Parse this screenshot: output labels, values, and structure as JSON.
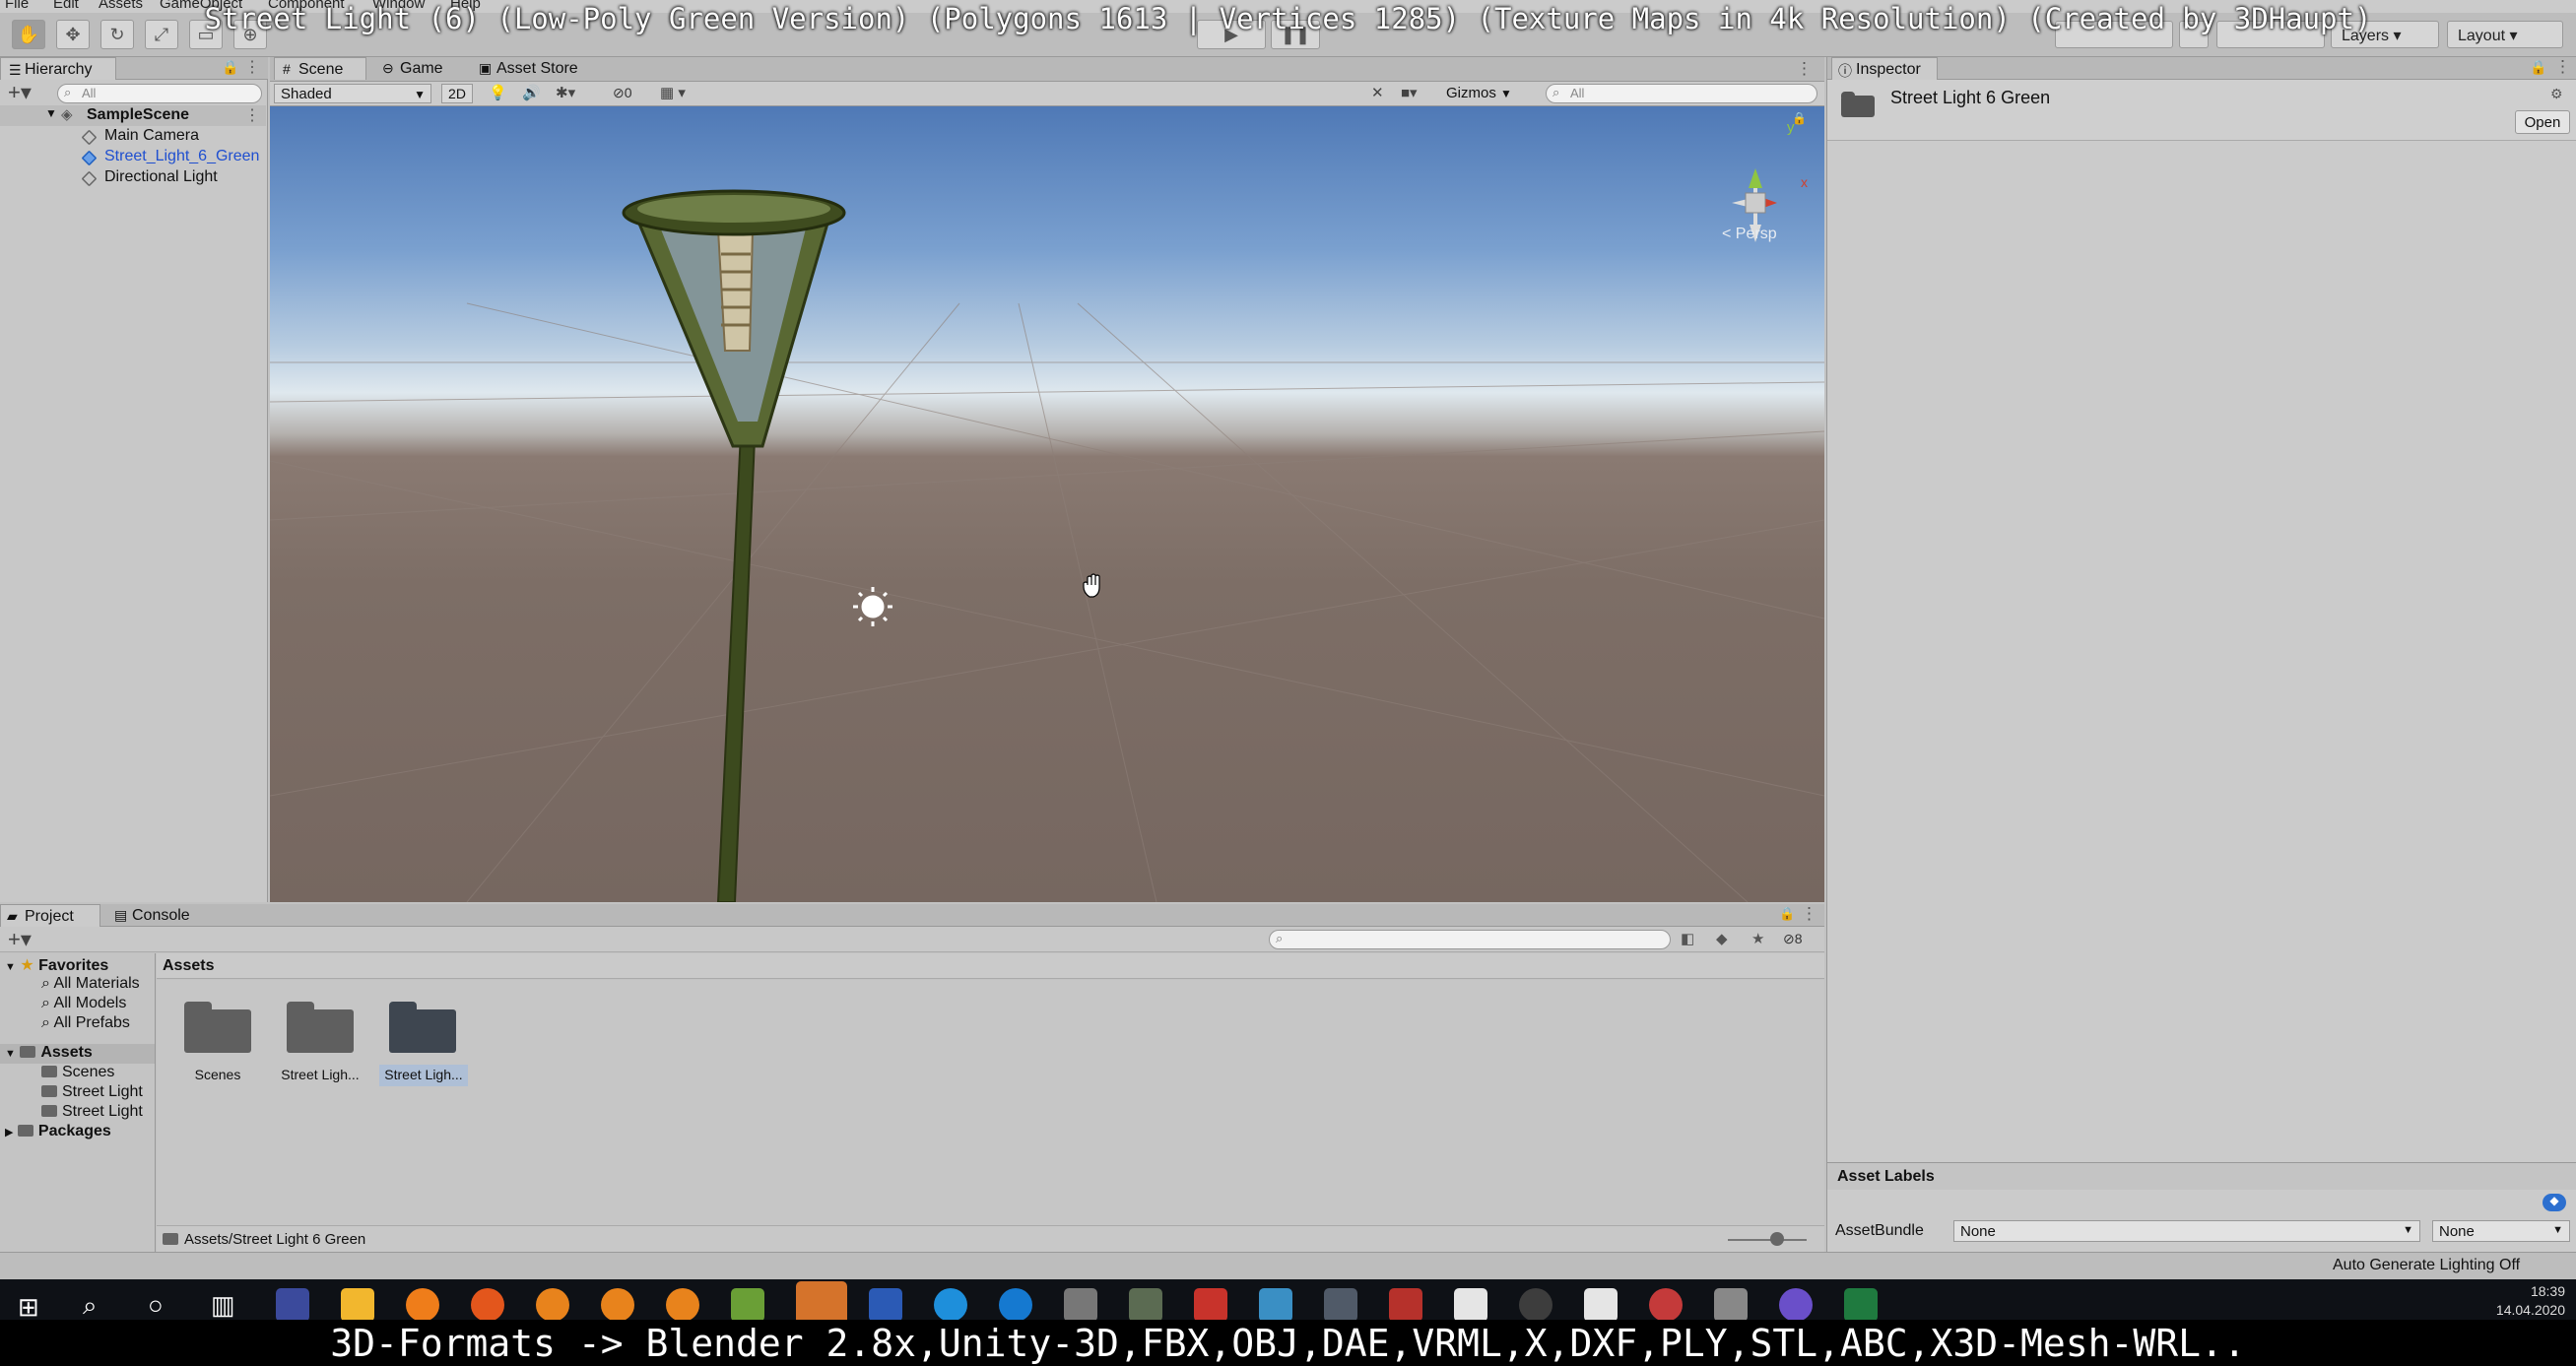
{
  "overlay": {
    "title": "Street Light (6) (Low-Poly Green Version) (Polygons 1613 | Vertices 1285) (Texture Maps in 4k Resolution) (Created by 3DHaupt)",
    "formats": "3D-Formats -> Blender 2.8x,Unity-3D,FBX,OBJ,DAE,VRML,X,DXF,PLY,STL,ABC,X3D-Mesh-WRL.."
  },
  "menu": [
    "File",
    "Edit",
    "Assets",
    "GameObject",
    "Component",
    "Window",
    "Help"
  ],
  "toolbar": {
    "layers": "Layers",
    "layout": "Layout"
  },
  "hierarchy": {
    "tab": "Hierarchy",
    "search_placeholder": "All",
    "scene": "SampleScene",
    "items": [
      "Main Camera",
      "Street_Light_6_Green",
      "Directional Light"
    ]
  },
  "scene_view": {
    "tabs": [
      "Scene",
      "Game",
      "Asset Store"
    ],
    "shading": "Shaded",
    "mode2d": "2D",
    "hidden_count": "0",
    "gizmos": "Gizmos",
    "search_placeholder": "All",
    "persp": "< Persp",
    "axis_x": "x",
    "axis_y": "y"
  },
  "inspector": {
    "tab": "Inspector",
    "asset_name": "Street Light 6 Green",
    "open_button": "Open",
    "asset_labels": "Asset Labels",
    "assetbundle_label": "AssetBundle",
    "assetbundle_value": "None",
    "variant_value": "None"
  },
  "project": {
    "tabs": [
      "Project",
      "Console"
    ],
    "badge": "8",
    "favorites": "Favorites",
    "favorite_items": [
      "All Materials",
      "All Models",
      "All Prefabs"
    ],
    "assets_root": "Assets",
    "asset_children": [
      "Scenes",
      "Street Light",
      "Street Light"
    ],
    "packages": "Packages",
    "grid_header": "Assets",
    "folders": [
      "Scenes",
      "Street Ligh...",
      "Street Ligh..."
    ],
    "path": "Assets/Street Light 6 Green"
  },
  "status": {
    "lighting": "Auto Generate Lighting Off"
  },
  "clock": {
    "time": "18:39",
    "date": "14.04.2020"
  }
}
